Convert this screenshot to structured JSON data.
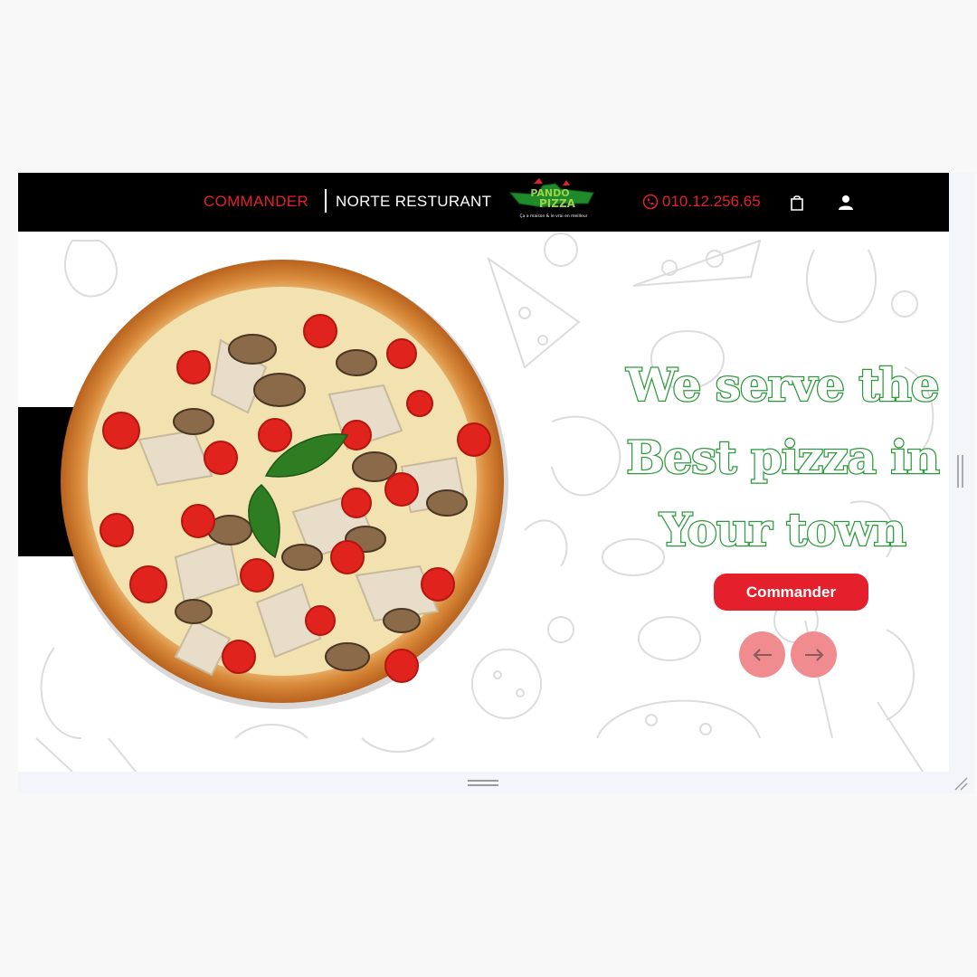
{
  "nav": {
    "commander": "COMMANDER",
    "resto": "NORTE RESTURANT",
    "phone": "010.12.256.65"
  },
  "logo": {
    "text_top": "PANDO",
    "text_bottom": "PIZZA",
    "tagline": "Ça a maison & le vrai en meilleur"
  },
  "hero": {
    "line1": "We serve the",
    "line2": "Best pizza in",
    "line3": "Your town",
    "cta": "Commander"
  },
  "colors": {
    "accent_red": "#e3202b",
    "headline_green": "#2a9a3a",
    "arrow_pink": "#f08b8f",
    "topbar": "#000000"
  },
  "icons": [
    "phone-icon",
    "shopping-bag-icon",
    "user-icon",
    "arrow-left-icon",
    "arrow-right-icon"
  ]
}
